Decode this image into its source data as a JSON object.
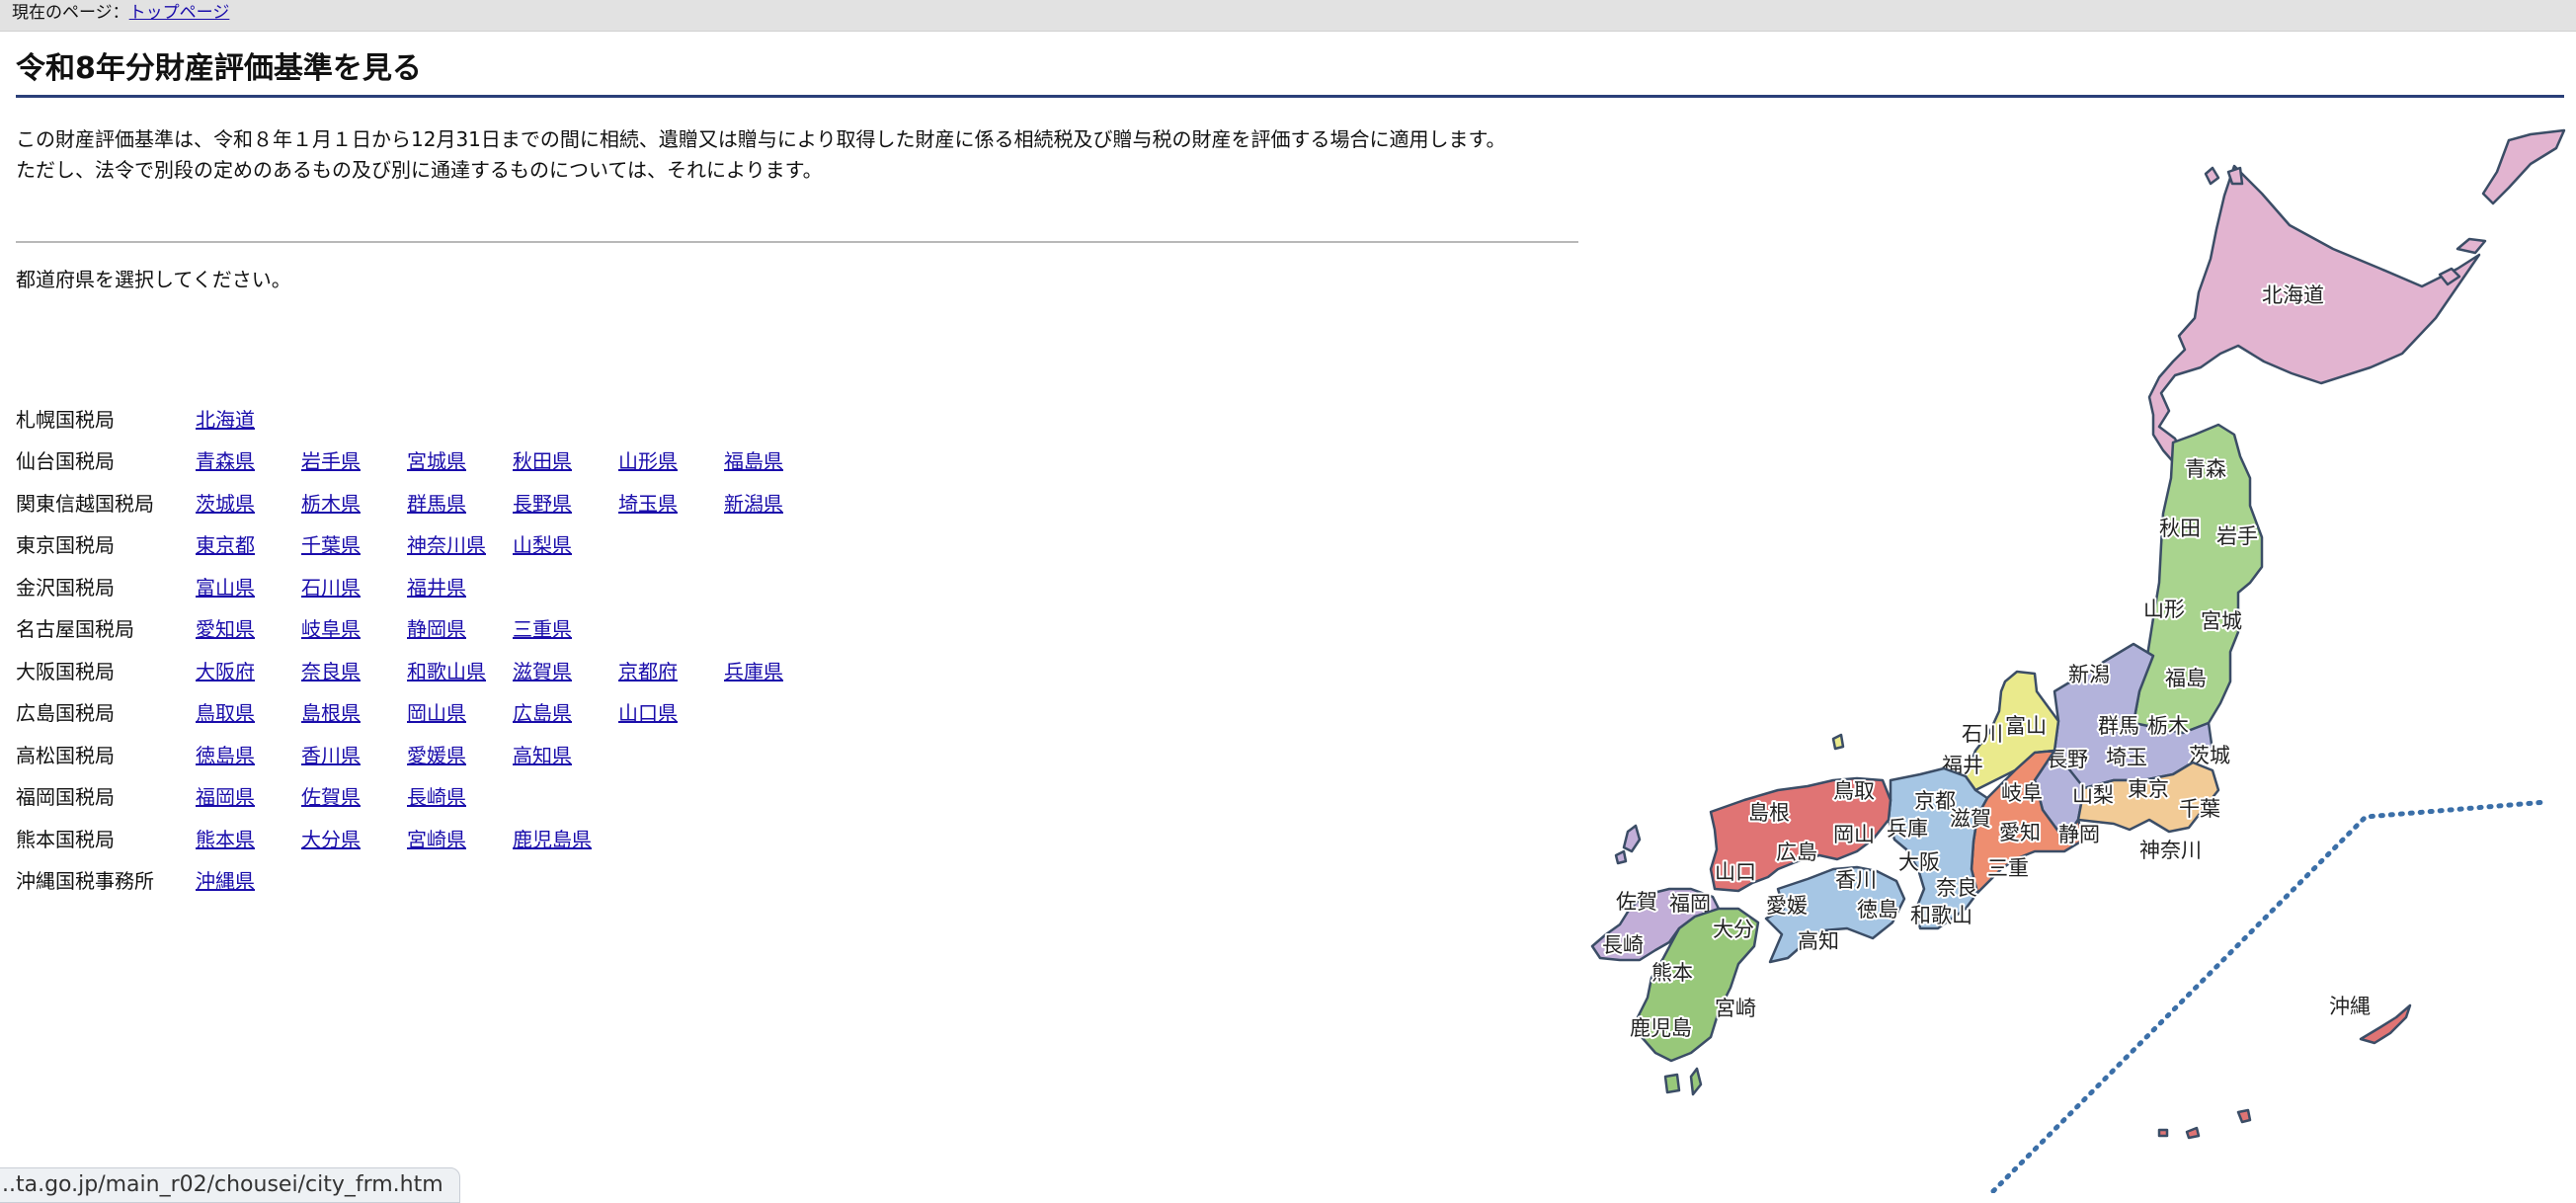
{
  "breadcrumb": {
    "prefix": "現在のページ：",
    "link": "トップページ"
  },
  "page_title": "令和8年分財産評価基準を見る",
  "intro": {
    "line1": "この財産評価基準は、令和８年１月１日から12月31日までの間に相続、遺贈又は贈与により取得した財産に係る相続税及び贈与税の財産を評価する場合に適用します。",
    "line2": "ただし、法令で別段の定めのあるもの及び別に通達するものについては、それによります。"
  },
  "prompt": "都道府県を選択してください。",
  "bureaus": [
    {
      "name": "札幌国税局",
      "prefs": [
        "北海道"
      ]
    },
    {
      "name": "仙台国税局",
      "prefs": [
        "青森県",
        "岩手県",
        "宮城県",
        "秋田県",
        "山形県",
        "福島県"
      ]
    },
    {
      "name": "関東信越国税局",
      "prefs": [
        "茨城県",
        "栃木県",
        "群馬県",
        "長野県",
        "埼玉県",
        "新潟県"
      ]
    },
    {
      "name": "東京国税局",
      "prefs": [
        "東京都",
        "千葉県",
        "神奈川県",
        "山梨県"
      ]
    },
    {
      "name": "金沢国税局",
      "prefs": [
        "富山県",
        "石川県",
        "福井県"
      ]
    },
    {
      "name": "名古屋国税局",
      "prefs": [
        "愛知県",
        "岐阜県",
        "静岡県",
        "三重県"
      ]
    },
    {
      "name": "大阪国税局",
      "prefs": [
        "大阪府",
        "奈良県",
        "和歌山県",
        "滋賀県",
        "京都府",
        "兵庫県"
      ]
    },
    {
      "name": "広島国税局",
      "prefs": [
        "鳥取県",
        "島根県",
        "岡山県",
        "広島県",
        "山口県"
      ]
    },
    {
      "name": "高松国税局",
      "prefs": [
        "徳島県",
        "香川県",
        "愛媛県",
        "高知県"
      ]
    },
    {
      "name": "福岡国税局",
      "prefs": [
        "福岡県",
        "佐賀県",
        "長崎県"
      ]
    },
    {
      "name": "熊本国税局",
      "prefs": [
        "熊本県",
        "大分県",
        "宮崎県",
        "鹿児島県"
      ]
    },
    {
      "name": "沖縄国税事務所",
      "prefs": [
        "沖縄県"
      ]
    }
  ],
  "map": {
    "labels": {
      "hokkaido": "北海道",
      "aomori": "青森",
      "akita": "秋田",
      "iwate": "岩手",
      "yamagata": "山形",
      "miyagi": "宮城",
      "niigata": "新潟",
      "fukushima": "福島",
      "ishikawa": "石川",
      "toyama": "富山",
      "gunma": "群馬",
      "tochigi": "栃木",
      "fukui": "福井",
      "nagano": "長野",
      "saitama": "埼玉",
      "ibaraki": "茨城",
      "gifu": "岐阜",
      "yamanashi": "山梨",
      "tokyo": "東京",
      "chiba": "千葉",
      "kyoto": "京都",
      "shimane": "島根",
      "tottori": "鳥取",
      "hyogo": "兵庫",
      "shiga": "滋賀",
      "aichi": "愛知",
      "shizuoka": "静岡",
      "kanagawa": "神奈川",
      "okayama": "岡山",
      "hiroshima": "広島",
      "yamaguchi": "山口",
      "osaka": "大阪",
      "mie": "三重",
      "kagawa": "香川",
      "nara": "奈良",
      "saga": "佐賀",
      "fukuoka": "福岡",
      "ehime": "愛媛",
      "tokushima": "徳島",
      "wakayama": "和歌山",
      "oita": "大分",
      "nagasaki": "長崎",
      "kochi": "高知",
      "kumamoto": "熊本",
      "miyazaki": "宮崎",
      "kagoshima": "鹿児島",
      "okinawa": "沖縄"
    },
    "colors": {
      "sapporo": "#e2b4d0",
      "sendai": "#a9d48e",
      "kanto": "#b3b3db",
      "tokyo": "#f2cb96",
      "kanazawa": "#eaea8c",
      "nagoya": "#ee8e70",
      "osaka": "#a6c6e4",
      "hiroshima": "#e07474",
      "takamatsu": "#a6c6e4",
      "fukuoka": "#c2aed8",
      "kumamoto": "#98c87a",
      "okinawa": "#e07474",
      "border": "#3b4d66",
      "divider": "#3b6fa8"
    }
  },
  "status_url": "...ta.go.jp/main_r02/chousei/city_frm.htm"
}
